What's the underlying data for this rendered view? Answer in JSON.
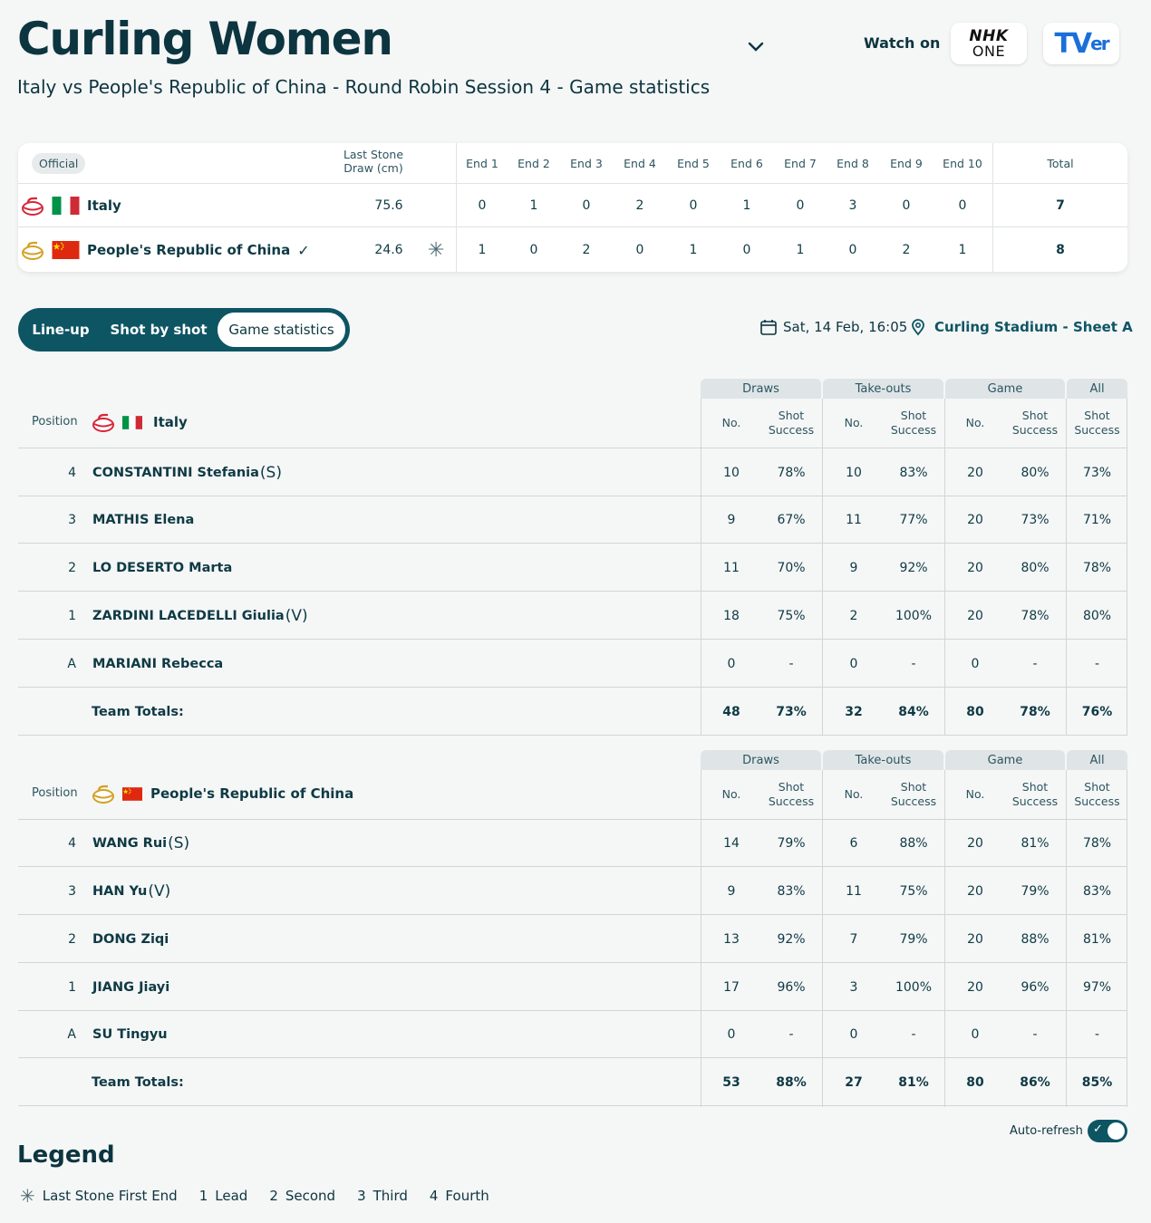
{
  "header": {
    "title": "Curling Women",
    "subtitle": "Italy vs People's Republic of China - Round Robin Session 4 - Game statistics",
    "watch_on": "Watch on",
    "broadcaster1_line1": "NHK",
    "broadcaster1_line2": "ONE",
    "broadcaster2_a": "TV",
    "broadcaster2_b": "er"
  },
  "scoreboard": {
    "official": "Official",
    "lsd_label_1": "Last Stone",
    "lsd_label_2": "Draw (cm)",
    "ends": [
      "End 1",
      "End 2",
      "End 3",
      "End 4",
      "End 5",
      "End 6",
      "End 7",
      "End 8",
      "End 9",
      "End 10"
    ],
    "total_label": "Total",
    "teams": [
      {
        "name": "Italy",
        "lsd": "75.6",
        "ends": [
          "0",
          "1",
          "0",
          "2",
          "0",
          "1",
          "0",
          "3",
          "0",
          "0"
        ],
        "total": "7",
        "stone_color": "#d6283c"
      },
      {
        "name": "People's Republic of China",
        "lsd": "24.6",
        "ends": [
          "1",
          "0",
          "2",
          "0",
          "1",
          "0",
          "1",
          "0",
          "2",
          "1"
        ],
        "total": "8",
        "stone_color": "#d4a126",
        "winner": "✓",
        "hammer": "✳"
      }
    ]
  },
  "tabs": [
    "Line-up",
    "Shot by shot",
    "Game statistics"
  ],
  "active_tab": "Game statistics",
  "date": "Sat, 14 Feb, 16:05",
  "venue": "Curling Stadium - Sheet A",
  "stats_headers": {
    "groups": [
      "Draws",
      "Take-outs",
      "Game",
      "All"
    ],
    "no": "No.",
    "shot_1": "Shot",
    "shot_2": "Success",
    "position": "Position",
    "team_totals": "Team Totals:"
  },
  "italy": {
    "team": "Italy",
    "players": [
      {
        "pos": "4",
        "name": "CONSTANTINI Stefania",
        "role": "(S)",
        "vals": [
          "10",
          "78%",
          "10",
          "83%",
          "20",
          "80%",
          "73%"
        ]
      },
      {
        "pos": "3",
        "name": "MATHIS Elena",
        "role": "",
        "vals": [
          "9",
          "67%",
          "11",
          "77%",
          "20",
          "73%",
          "71%"
        ]
      },
      {
        "pos": "2",
        "name": "LO DESERTO Marta",
        "role": "",
        "vals": [
          "11",
          "70%",
          "9",
          "92%",
          "20",
          "80%",
          "78%"
        ]
      },
      {
        "pos": "1",
        "name": "ZARDINI LACEDELLI Giulia",
        "role": "(V)",
        "vals": [
          "18",
          "75%",
          "2",
          "100%",
          "20",
          "78%",
          "80%"
        ]
      },
      {
        "pos": "A",
        "name": "MARIANI Rebecca",
        "role": "",
        "vals": [
          "0",
          "-",
          "0",
          "-",
          "0",
          "-",
          "-"
        ]
      }
    ],
    "totals": [
      "48",
      "73%",
      "32",
      "84%",
      "80",
      "78%",
      "76%"
    ]
  },
  "china": {
    "team": "People's Republic of China",
    "players": [
      {
        "pos": "4",
        "name": "WANG Rui",
        "role": "(S)",
        "vals": [
          "14",
          "79%",
          "6",
          "88%",
          "20",
          "81%",
          "78%"
        ]
      },
      {
        "pos": "3",
        "name": "HAN Yu",
        "role": "(V)",
        "vals": [
          "9",
          "83%",
          "11",
          "75%",
          "20",
          "79%",
          "83%"
        ]
      },
      {
        "pos": "2",
        "name": "DONG Ziqi",
        "role": "",
        "vals": [
          "13",
          "92%",
          "7",
          "79%",
          "20",
          "88%",
          "81%"
        ]
      },
      {
        "pos": "1",
        "name": "JIANG Jiayi",
        "role": "",
        "vals": [
          "17",
          "96%",
          "3",
          "100%",
          "20",
          "96%",
          "97%"
        ]
      },
      {
        "pos": "A",
        "name": "SU Tingyu",
        "role": "",
        "vals": [
          "0",
          "-",
          "0",
          "-",
          "0",
          "-",
          "-"
        ]
      }
    ],
    "totals": [
      "53",
      "88%",
      "27",
      "81%",
      "80",
      "86%",
      "85%"
    ]
  },
  "footer": {
    "auto_refresh": "Auto-refresh",
    "auto_refresh_on": true,
    "legend_title": "Legend",
    "legend_items": [
      {
        "key": "✳",
        "label": "Last Stone First End"
      },
      {
        "key": "1",
        "label": "Lead"
      },
      {
        "key": "2",
        "label": "Second"
      },
      {
        "key": "3",
        "label": "Third"
      },
      {
        "key": "4",
        "label": "Fourth"
      }
    ]
  },
  "colors": {
    "primary": "#0e5564",
    "text": "#0c3540",
    "italy_stone": "#d6283c",
    "china_stone": "#d4a126"
  }
}
